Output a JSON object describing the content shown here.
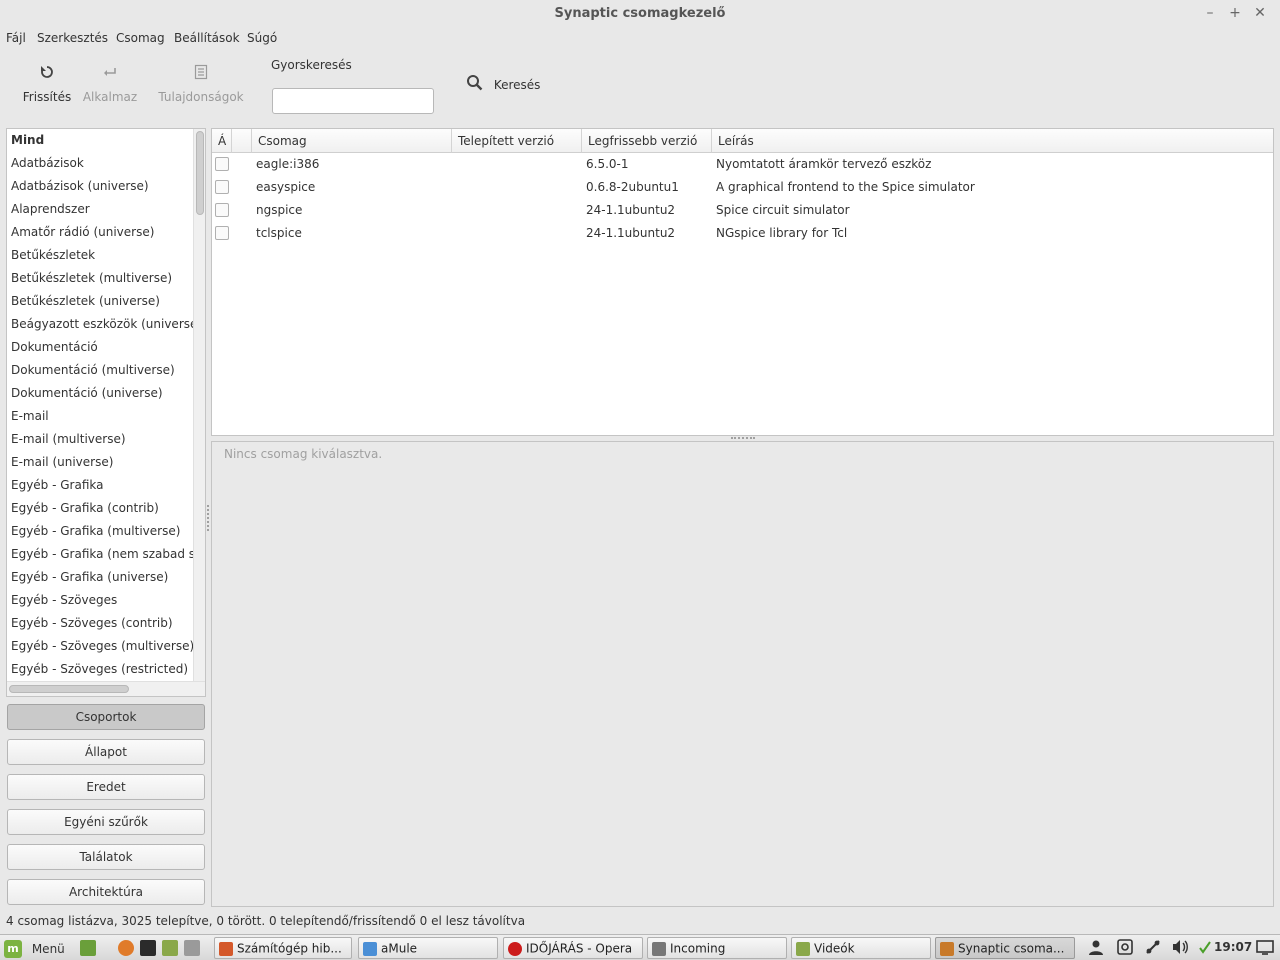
{
  "window": {
    "title": "Synaptic csomagkezelő",
    "controls": {
      "minimize": "–",
      "maximize": "+",
      "close": "✕"
    }
  },
  "menu": [
    "Fájl",
    "Szerkesztés",
    "Csomag",
    "Beállítások",
    "Súgó"
  ],
  "toolbar": {
    "refresh_label": "Frissítés",
    "apply_label": "Alkalmaz",
    "properties_label": "Tulajdonságok",
    "quicksearch_label": "Gyorskeresés",
    "quicksearch_value": "",
    "search_label": "Keresés"
  },
  "sections": [
    "Mind",
    "Adatbázisok",
    "Adatbázisok (universe)",
    "Alaprendszer",
    "Amatőr rádió (universe)",
    "Betűkészletek",
    "Betűkészletek (multiverse)",
    "Betűkészletek (universe)",
    "Beágyazott eszközök (universe)",
    "Dokumentáció",
    "Dokumentáció (multiverse)",
    "Dokumentáció (universe)",
    "E-mail",
    "E-mail (multiverse)",
    "E-mail (universe)",
    "Egyéb - Grafika",
    "Egyéb - Grafika (contrib)",
    "Egyéb - Grafika (multiverse)",
    "Egyéb - Grafika (nem szabad szoftver)",
    "Egyéb - Grafika (universe)",
    "Egyéb - Szöveges",
    "Egyéb - Szöveges (contrib)",
    "Egyéb - Szöveges (multiverse)",
    "Egyéb - Szöveges (restricted)"
  ],
  "filters": [
    "Csoportok",
    "Állapot",
    "Eredet",
    "Egyéni szűrők",
    "Találatok",
    "Architektúra"
  ],
  "table": {
    "headers": {
      "status": "Á",
      "mark": "",
      "package": "Csomag",
      "installed": "Telepített verzió",
      "latest": "Legfrissebb verzió",
      "description": "Leírás"
    },
    "rows": [
      {
        "package": "eagle:i386",
        "installed": "",
        "latest": "6.5.0-1",
        "description": "Nyomtatott áramkör tervező eszköz"
      },
      {
        "package": "easyspice",
        "installed": "",
        "latest": "0.6.8-2ubuntu1",
        "description": "A graphical frontend to the Spice simulator"
      },
      {
        "package": "ngspice",
        "installed": "",
        "latest": "24-1.1ubuntu2",
        "description": "Spice circuit simulator"
      },
      {
        "package": "tclspice",
        "installed": "",
        "latest": "24-1.1ubuntu2",
        "description": "NGspice library for Tcl"
      }
    ]
  },
  "details_placeholder": "Nincs csomag kiválasztva.",
  "status_text": "4 csomag listázva, 3025 telepítve, 0 törött. 0 telepítendő/frissítendő 0 el lesz távolítva",
  "taskbar": {
    "menu_label": "Menü",
    "tasks": [
      {
        "label": "Számítógép hib...",
        "color": "#d4582a"
      },
      {
        "label": "aMule",
        "color": "#4a8fd6"
      },
      {
        "label": "IDŐJÁRÁS - Opera",
        "color": "#cc1b1b"
      },
      {
        "label": "Incoming",
        "color": "#777777"
      },
      {
        "label": "Videók",
        "color": "#8aa84a"
      },
      {
        "label": "Synaptic csoma...",
        "color": "#c87a2a"
      }
    ],
    "clock": "19:07"
  },
  "colors": {
    "accent": "#7cb342",
    "selected_filter": "#c9c9c9",
    "panel_bg": "#e8e8e8"
  }
}
